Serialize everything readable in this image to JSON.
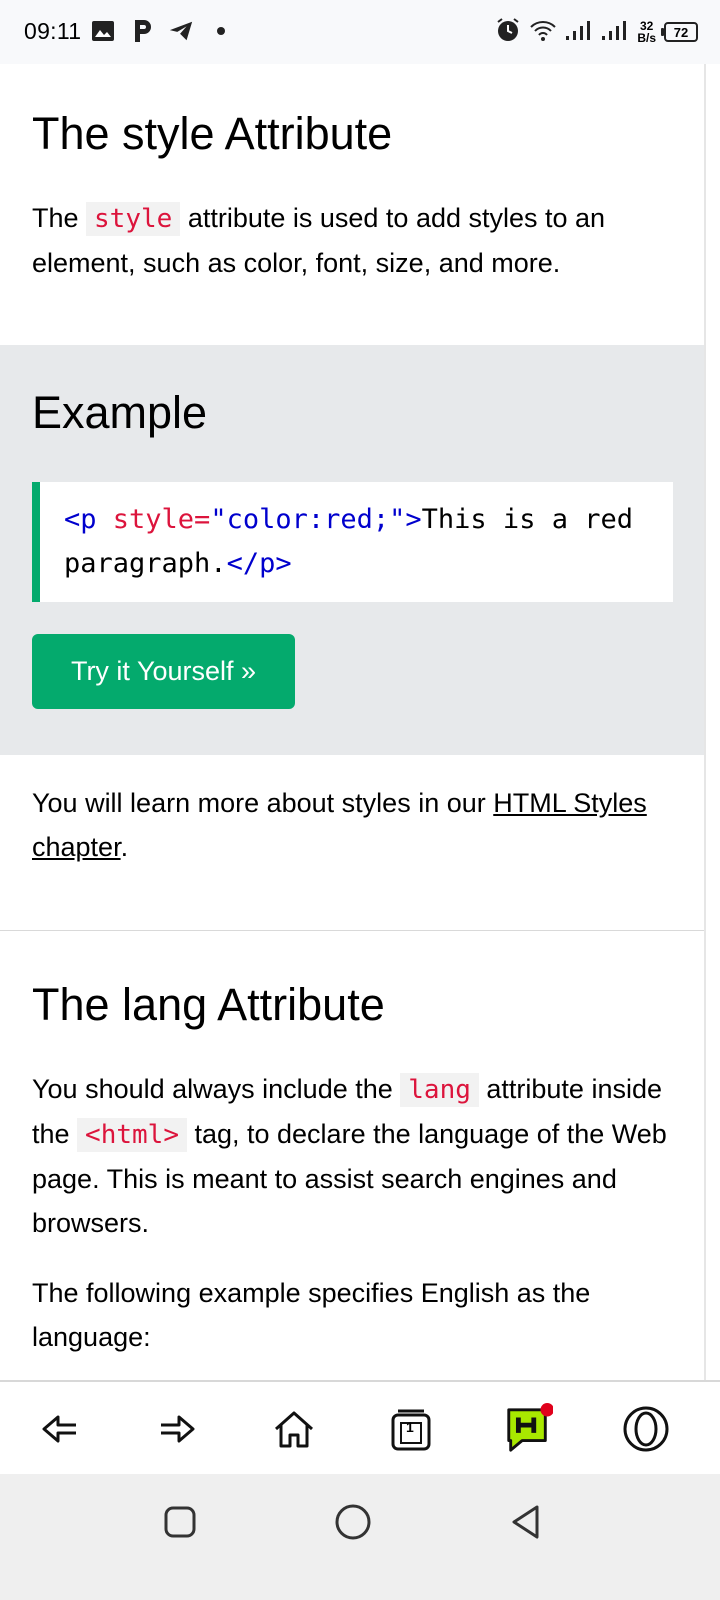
{
  "status_bar": {
    "time": "09:11",
    "icons_left": [
      "image-icon",
      "p-app-icon",
      "telegram-icon",
      "dot-icon"
    ],
    "icons_right": [
      "alarm-icon",
      "wifi-icon",
      "signal-1-icon",
      "signal-2-icon"
    ],
    "net_speed_value": "32",
    "net_speed_unit": "B/s",
    "battery_level": "72"
  },
  "section1": {
    "heading": "The style Attribute",
    "para_before": "The ",
    "para_code": "style",
    "para_after": " attribute is used to add styles to an element, such as color, font, size, and more."
  },
  "example": {
    "heading": "Example",
    "code": {
      "open_tag_start": "<p",
      "attr_name": " style=",
      "attr_value": "\"color:red;\"",
      "open_tag_end": ">",
      "text": "This is a red paragraph.",
      "close_tag": "</p>"
    },
    "button_label": "Try it Yourself »"
  },
  "more": {
    "before": "You will learn more about styles in our ",
    "link": "HTML Styles chapter",
    "after": "."
  },
  "section2": {
    "heading": "The lang Attribute",
    "p1_a": "You should always include the ",
    "p1_code1": "lang",
    "p1_b": " attribute inside the ",
    "p1_code2": "<html>",
    "p1_c": " tag, to declare the language of the Web page. This is meant to assist search engines and browsers.",
    "p2": "The following example specifies English as the language:"
  },
  "browser_bar": {
    "buttons": [
      "back-icon",
      "forward-icon",
      "home-icon",
      "tabs-icon",
      "hype-icon",
      "opera-menu-icon"
    ],
    "tab_count": "1"
  },
  "system_nav": [
    "recents-icon",
    "home-circle-icon",
    "back-triangle-icon"
  ],
  "colors": {
    "accent_green": "#04aa6d",
    "code_red": "#dc143c",
    "code_blue": "#0000cd",
    "example_bg": "#e7e9eb"
  }
}
